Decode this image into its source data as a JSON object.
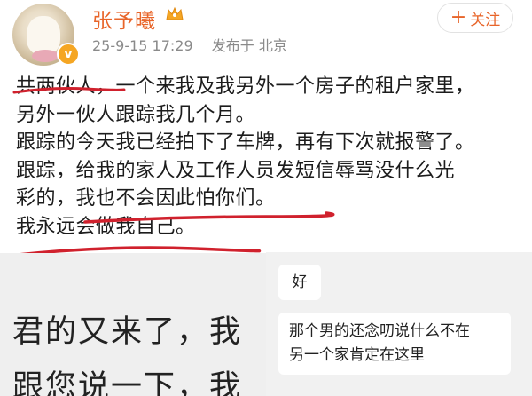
{
  "post": {
    "username": "张予曦",
    "timestamp": "25-9-15 17:29",
    "location": "发布于 北京",
    "follow_label": "关注",
    "follow_plus": "+",
    "verified_icon": "v-badge-icon",
    "lines": [
      "共两伙人，一个来我及我另外一个房子的租户家里，",
      "另外一伙人跟踪我几个月。",
      "跟踪的今天我已经拍下了车牌，再有下次就报警了。",
      "跟踪，给我的家人及工作人员发短信辱骂没什么光",
      "彩的，我也不会因此怕你们。",
      "我永远会做我自己。"
    ]
  },
  "screenshot": {
    "left_lines": [
      "君的又来了，我",
      "跟您说一下，我"
    ],
    "bubble_1": "好",
    "bubble_2_line1": "那个男的还念叨说什么不在",
    "bubble_2_line2": "另一个家肯定在这里"
  },
  "colors": {
    "accent": "#e8652a",
    "underline": "#d0212d",
    "meta": "#8a8a8a"
  }
}
